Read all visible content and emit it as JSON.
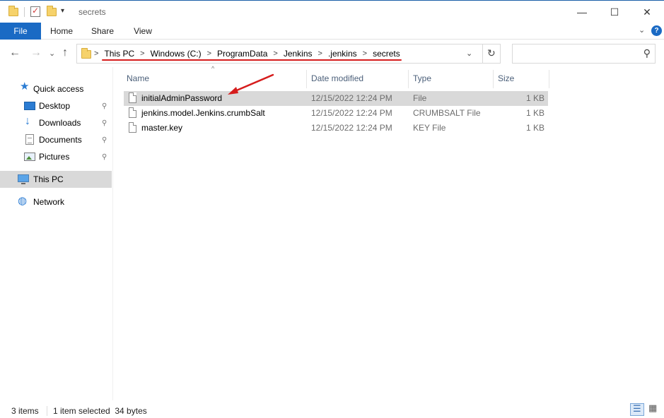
{
  "window": {
    "title": "secrets",
    "minimize_glyph": "—",
    "maximize_glyph": "☐",
    "close_glyph": "✕"
  },
  "ribbon": {
    "tabs": [
      {
        "label": "File",
        "active": true
      },
      {
        "label": "Home"
      },
      {
        "label": "Share"
      },
      {
        "label": "View"
      }
    ],
    "expand_glyph": "⌄",
    "help_glyph": "?"
  },
  "nav": {
    "back_glyph": "←",
    "forward_glyph": "→",
    "recent_glyph": "⌄",
    "up_glyph": "↑",
    "breadcrumbs": [
      "This PC",
      "Windows (C:)",
      "ProgramData",
      "Jenkins",
      ".jenkins",
      "secrets"
    ],
    "crumb_sep": ">",
    "dropdown_glyph": "⌄",
    "refresh_glyph": "↻",
    "search_placeholder": "",
    "search_glyph": "⚲"
  },
  "sidebar": {
    "items": [
      {
        "label": "Quick access",
        "icon": "star-icon",
        "pinned": false
      },
      {
        "label": "Desktop",
        "icon": "desktop-icon",
        "pinned": true
      },
      {
        "label": "Downloads",
        "icon": "download-icon",
        "pinned": true
      },
      {
        "label": "Documents",
        "icon": "documents-icon",
        "pinned": true
      },
      {
        "label": "Pictures",
        "icon": "pictures-icon",
        "pinned": true
      },
      {
        "label": "This PC",
        "icon": "this-pc-icon",
        "selected": true
      },
      {
        "label": "Network",
        "icon": "network-icon"
      }
    ],
    "pin_glyph": "📌"
  },
  "file_list": {
    "columns": [
      "Name",
      "Date modified",
      "Type",
      "Size"
    ],
    "sort_glyph": "^",
    "rows": [
      {
        "name": "initialAdminPassword",
        "date": "12/15/2022 12:24 PM",
        "type": "File",
        "size": "1 KB",
        "selected": true
      },
      {
        "name": "jenkins.model.Jenkins.crumbSalt",
        "date": "12/15/2022 12:24 PM",
        "type": "CRUMBSALT File",
        "size": "1 KB"
      },
      {
        "name": "master.key",
        "date": "12/15/2022 12:24 PM",
        "type": "KEY File",
        "size": "1 KB"
      }
    ]
  },
  "status": {
    "item_count": "3 items",
    "selection": "1 item selected  34 bytes"
  },
  "colors": {
    "accent": "#1a6ac4",
    "annotation": "#d61d1d",
    "selection": "#d9d9d9"
  }
}
